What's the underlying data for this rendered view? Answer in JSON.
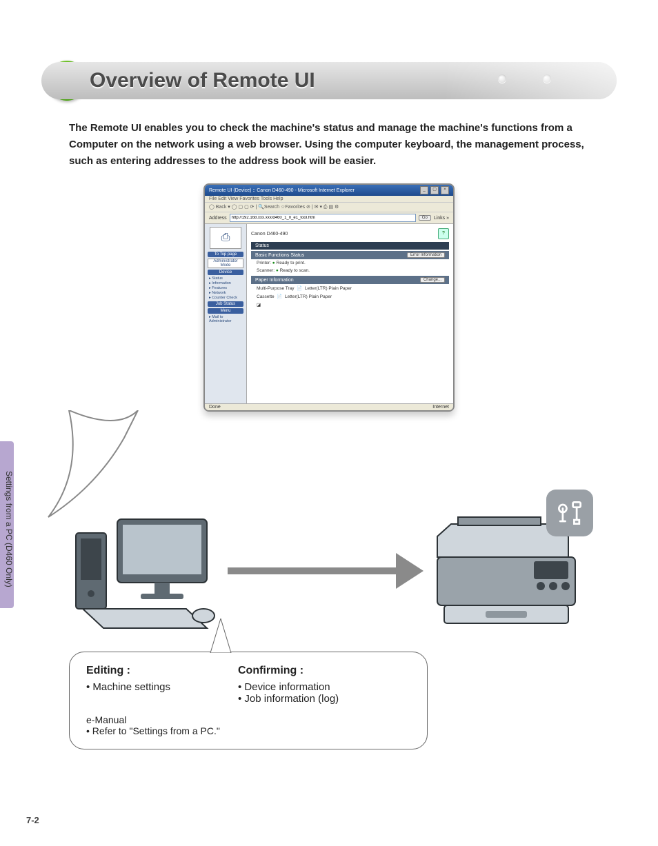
{
  "title": "Overview of Remote UI",
  "intro": "The Remote UI enables you to check the machine's status and manage the machine's functions from a Computer on the network using a web browser. Using the computer keyboard, the management process, such as entering addresses to the address book will be easier.",
  "side_tab": "Settings from a PC (D460 Only)",
  "page_num": "7-2",
  "browser": {
    "window_title": "Remote UI (Device) :: Canon D460-490 - Microsoft Internet Explorer",
    "menus": "File  Edit  View  Favorites  Tools  Help",
    "toolbar": "◯ Back ▾  ◯  ▢ ▢ ⟳ | 🔍Search ☆Favorites ⊘ | ✉ ▾ ⎙ ▤ ⚙",
    "addr_label": "Address",
    "addr_value": "http://192.168.xxx.xxx/d460_1_0_e1_tool.htm",
    "go": "Go",
    "links": "Links »",
    "device_name": "Canon D460-490",
    "help": "?",
    "sidebar": {
      "to_top": "To Top page",
      "admin_mode": "Administrator Mode",
      "device_btn": "Device",
      "links": [
        "Status",
        "Information",
        "Features",
        "Network",
        "Counter Check"
      ],
      "job_status": "Job Status",
      "menu": "Menu",
      "mail_admin": "Mail to Administrator"
    },
    "panels": {
      "status": "Status",
      "basic_header": "Basic Functions Status",
      "error_btn": "Error Information",
      "printer_lbl": "Printer:",
      "printer_val": "Ready to print.",
      "scanner_lbl": "Scanner:",
      "scanner_val": "Ready to scan.",
      "paper_header": "Paper Information",
      "change_btn": "Change...",
      "mp_tray": "Multi-Purpose Tray",
      "mp_val": "Letter(LTR) Plain Paper",
      "cassette": "Cassette",
      "cassette_val": "Letter(LTR) Plain Paper"
    },
    "status_done": "Done",
    "status_zone": "Internet"
  },
  "callout": {
    "editing_h": "Editing :",
    "editing_items": [
      "Machine settings"
    ],
    "confirming_h": "Confirming :",
    "confirming_items": [
      "Device information",
      "Job information (log)"
    ],
    "emanual": "e-Manual",
    "refer": "Refer to \"Settings from a PC.\""
  }
}
